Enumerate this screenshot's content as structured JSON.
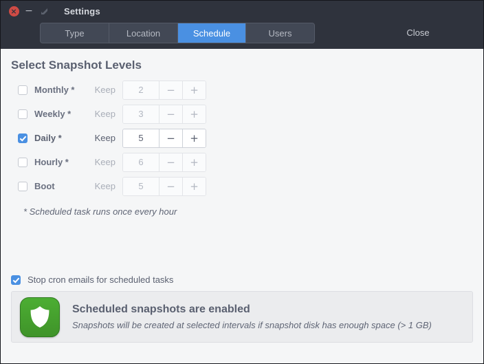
{
  "window": {
    "title": "Settings",
    "controls": {
      "close": "×",
      "minimize": "−",
      "maximize": "maximize-icon"
    }
  },
  "tabs": {
    "items": [
      {
        "label": "Type",
        "selected": false
      },
      {
        "label": "Location",
        "selected": false
      },
      {
        "label": "Schedule",
        "selected": true
      },
      {
        "label": "Users",
        "selected": false
      }
    ],
    "close_label": "Close"
  },
  "main": {
    "section_title": "Select Snapshot Levels",
    "keep_label": "Keep",
    "minus_label": "−",
    "plus_label": "+",
    "levels": [
      {
        "name": "Monthly *",
        "checked": false,
        "keep": "2"
      },
      {
        "name": "Weekly *",
        "checked": false,
        "keep": "3"
      },
      {
        "name": "Daily *",
        "checked": true,
        "keep": "5"
      },
      {
        "name": "Hourly *",
        "checked": false,
        "keep": "6"
      },
      {
        "name": "Boot",
        "checked": false,
        "keep": "5"
      }
    ],
    "footnote": "* Scheduled task runs once every hour",
    "cron": {
      "label": "Stop cron emails for scheduled tasks",
      "checked": true
    },
    "info": {
      "icon": "shield-icon",
      "heading": "Scheduled snapshots are enabled",
      "subtext": "Snapshots will be created at selected intervals if snapshot disk has enough space (> 1 GB)"
    }
  },
  "colors": {
    "titlebar": "#2f333d",
    "accent": "#4a90e2",
    "close_red": "#cf4b45",
    "shield_green": "#45a32b",
    "body": "#f5f6f7",
    "text": "#5a6070"
  }
}
